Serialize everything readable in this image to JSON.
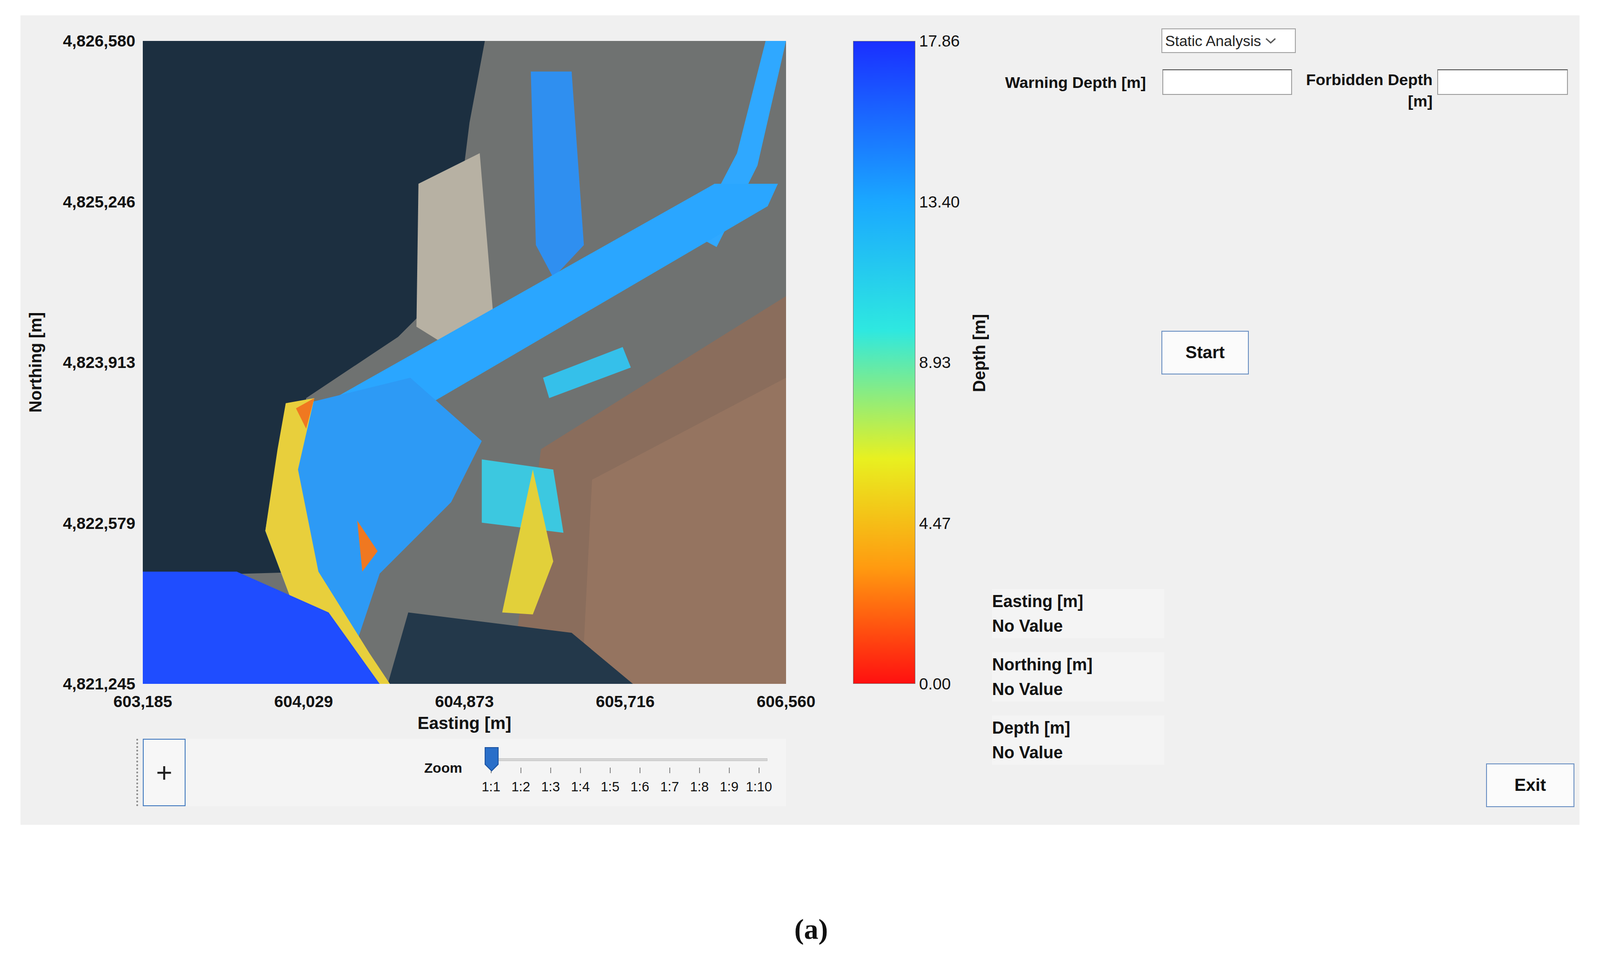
{
  "plot": {
    "y_axis": {
      "title": "Northing [m]",
      "ticks": [
        "4,826,580",
        "4,825,246",
        "4,823,913",
        "4,822,579",
        "4,821,245"
      ]
    },
    "x_axis": {
      "title": "Easting [m]",
      "ticks": [
        "603,185",
        "604,029",
        "604,873",
        "605,716",
        "606,560"
      ]
    },
    "colorbar": {
      "title": "Depth [m]",
      "ticks": [
        "17.86",
        "13.40",
        "8.93",
        "4.47",
        "0.00"
      ]
    }
  },
  "toolbar": {
    "add_button": "+",
    "zoom": {
      "label": "Zoom",
      "ticks": [
        "1:1",
        "1:2",
        "1:3",
        "1:4",
        "1:5",
        "1:6",
        "1:7",
        "1:8",
        "1:9",
        "1:10"
      ],
      "level": 0
    }
  },
  "controls": {
    "mode_dropdown": {
      "value": "Static Analysis"
    },
    "warning_depth": {
      "label": "Warning Depth [m]",
      "value": ""
    },
    "forbidden_depth": {
      "label": "Forbidden Depth [m]",
      "value": ""
    },
    "start_button": "Start"
  },
  "readouts": [
    {
      "label": "Easting [m]",
      "value": "No Value"
    },
    {
      "label": "Northing [m]",
      "value": "No Value"
    },
    {
      "label": "Depth [m]",
      "value": "No Value"
    }
  ],
  "exit_button": "Exit",
  "caption": "(a)"
}
